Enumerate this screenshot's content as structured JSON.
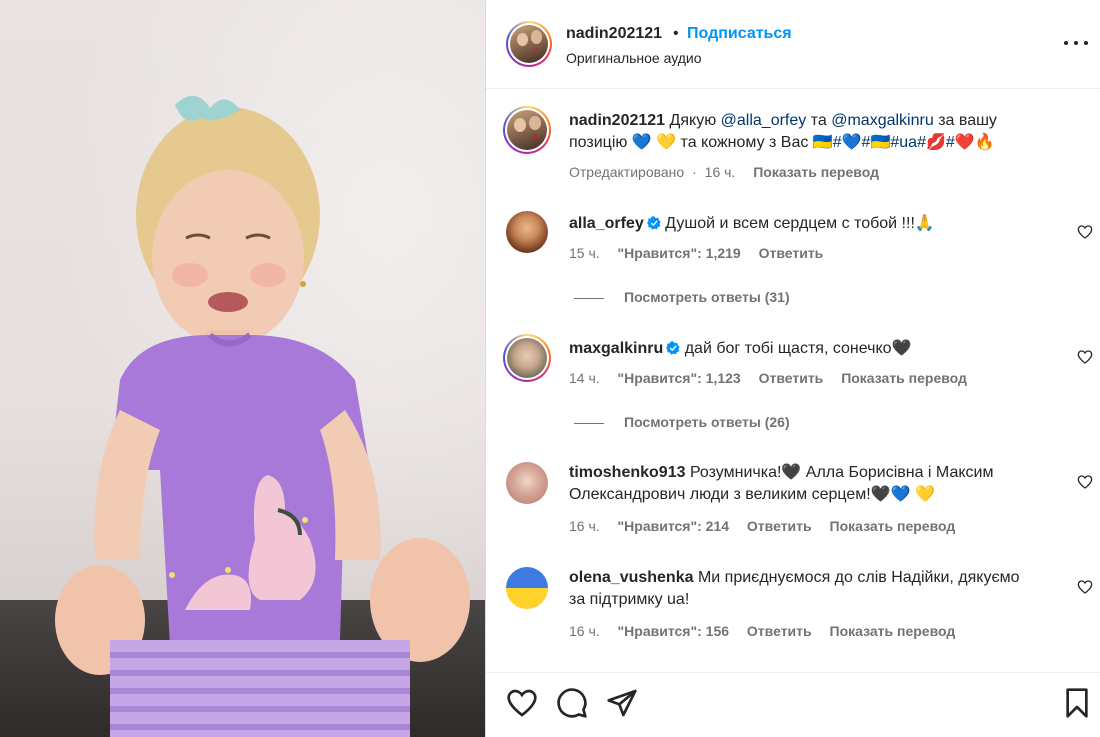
{
  "header": {
    "username": "nadin202121",
    "dot": "•",
    "follow_label": "Подписаться",
    "audio_label": "Оригинальное аудио"
  },
  "caption": {
    "username": "nadin202121",
    "text_1": "Дякую",
    "mention_1": "@alla_orfey",
    "text_2": "та",
    "mention_2": "@maxgalkinru",
    "text_3": "за вашу позицію 💙 💛 та кожному з Вас",
    "tags": "🇺🇦#💙#🇺🇦#ua#💋#❤️🔥",
    "edited": "Отредактировано",
    "time": "16 ч.",
    "translate": "Показать перевод"
  },
  "comments": [
    {
      "username": "alla_orfey",
      "verified": true,
      "text": "Душой и всем сердцем с тобой !!!🙏",
      "time": "15 ч.",
      "likes": "\"Нравится\": 1,219",
      "reply": "Ответить",
      "translate": "",
      "replies": "Посмотреть ответы (31)"
    },
    {
      "username": "maxgalkinru",
      "verified": true,
      "text": "дай бог тобі щастя, сонечко🖤",
      "time": "14 ч.",
      "likes": "\"Нравится\": 1,123",
      "reply": "Ответить",
      "translate": "Показать перевод",
      "replies": "Посмотреть ответы (26)"
    },
    {
      "username": "timoshenko913",
      "verified": false,
      "text": "Розумничка!🖤 Алла Борисівна і Максим Олександрович люди з великим серцем!🖤💙 💛",
      "time": "16 ч.",
      "likes": "\"Нравится\": 214",
      "reply": "Ответить",
      "translate": "Показать перевод",
      "replies": ""
    },
    {
      "username": "olena_vushenka",
      "verified": false,
      "text": "Ми приєднуємося до слів Надійки, дякуємо за підтримку ua!",
      "time": "16 ч.",
      "likes": "\"Нравится\": 156",
      "reply": "Ответить",
      "translate": "Показать перевод",
      "replies": ""
    }
  ],
  "icons": {
    "like": "heart-icon",
    "comment": "comment-icon",
    "share": "share-icon",
    "save": "bookmark-icon",
    "more": "more-icon",
    "verified": "verified-badge-icon"
  },
  "colors": {
    "accent": "#0095f6",
    "verified": "#0095f6",
    "mention": "#00376b",
    "secondary_text": "#737373"
  }
}
